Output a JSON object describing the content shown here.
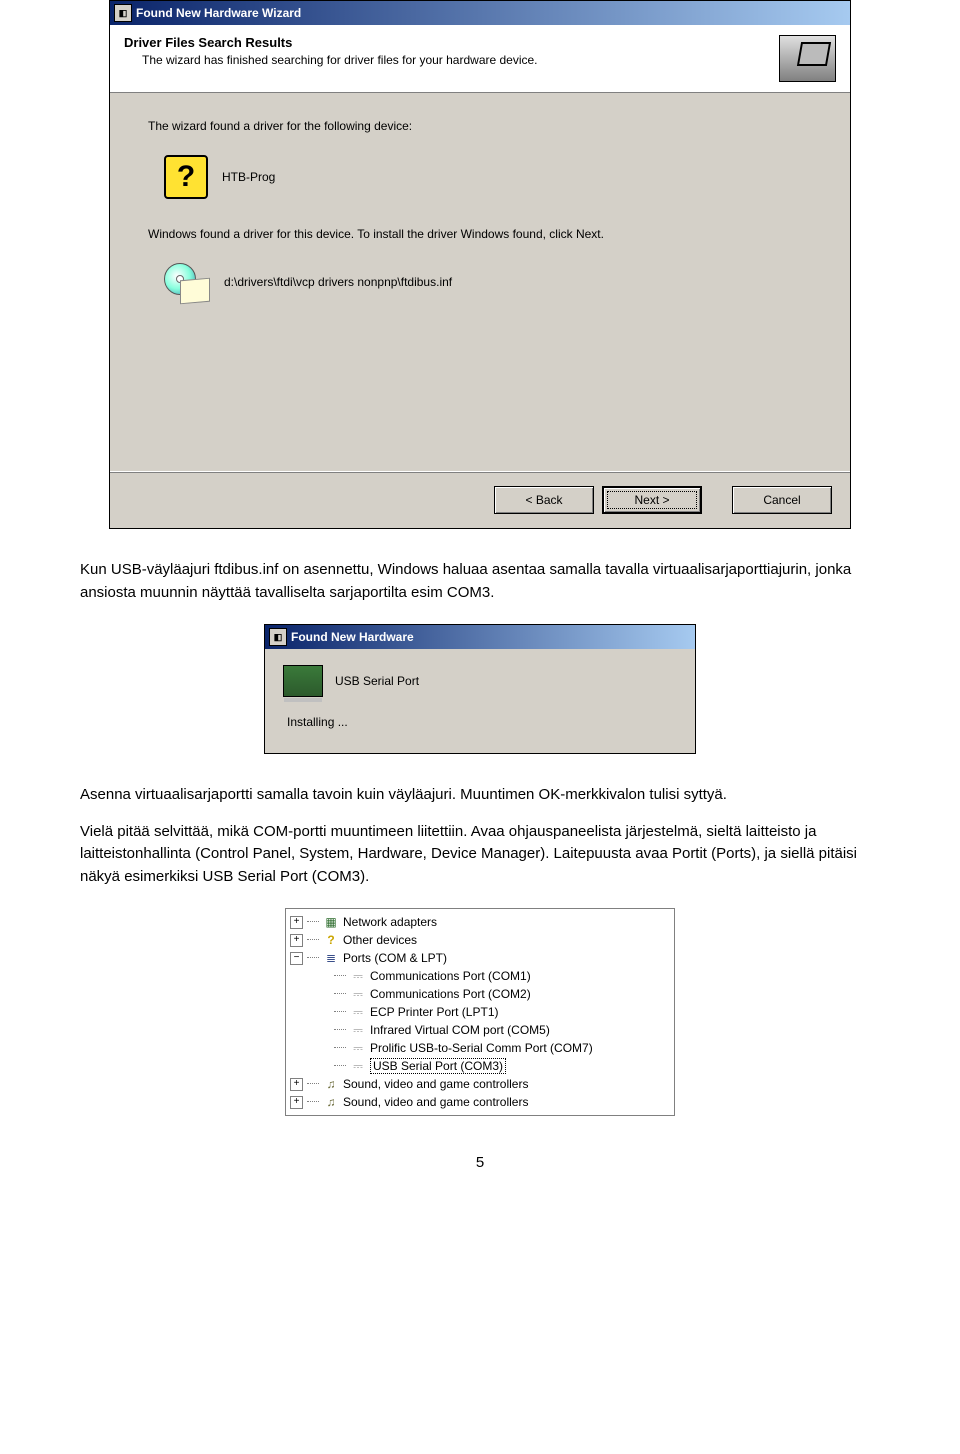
{
  "wizard": {
    "window_title": "Found New Hardware Wizard",
    "heading": "Driver Files Search Results",
    "subheading": "The wizard has finished searching for driver files for your hardware device.",
    "found_intro": "The wizard found a driver for the following device:",
    "device_name": "HTB-Prog",
    "found_message": "Windows found a driver for this device. To install the driver Windows found, click Next.",
    "driver_path": "d:\\drivers\\ftdi\\vcp drivers nonpnp\\ftdibus.inf",
    "back_label": "< Back",
    "next_label": "Next >",
    "cancel_label": "Cancel"
  },
  "paragraph1": "Kun USB-väyläajuri ftdibus.inf on asennettu, Windows haluaa asentaa samalla tavalla virtuaalisarjaporttiajurin, jonka ansiosta muunnin näyttää tavalliselta sarjaportilta esim COM3.",
  "found_hw": {
    "window_title": "Found New Hardware",
    "device": "USB Serial Port",
    "status": "Installing ..."
  },
  "paragraph2": "Asenna virtuaalisarjaportti samalla tavoin kuin väyläajuri. Muuntimen OK-merkkivalon tulisi syttyä.",
  "paragraph3": "Vielä pitää selvittää, mikä COM-portti muuntimeen liitettiin. Avaa ohjauspaneelista järjestelmä, sieltä laitteisto ja laitteistonhallinta (Control Panel, System, Hardware, Device Manager). Laitepuusta avaa Portit (Ports), ja siellä pitäisi näkyä esimerkiksi USB Serial Port (COM3).",
  "tree": {
    "network_adapters": "Network adapters",
    "other_devices": "Other devices",
    "ports": "Ports (COM & LPT)",
    "com1": "Communications Port (COM1)",
    "com2": "Communications Port (COM2)",
    "lpt1": "ECP Printer Port (LPT1)",
    "ir": "Infrared Virtual COM port (COM5)",
    "prolific": "Prolific USB-to-Serial Comm Port (COM7)",
    "usbserial": "USB Serial Port (COM3)",
    "sound1": "Sound, video and game controllers",
    "sound2": "Sound, video and game controllers"
  },
  "page_number": "5"
}
